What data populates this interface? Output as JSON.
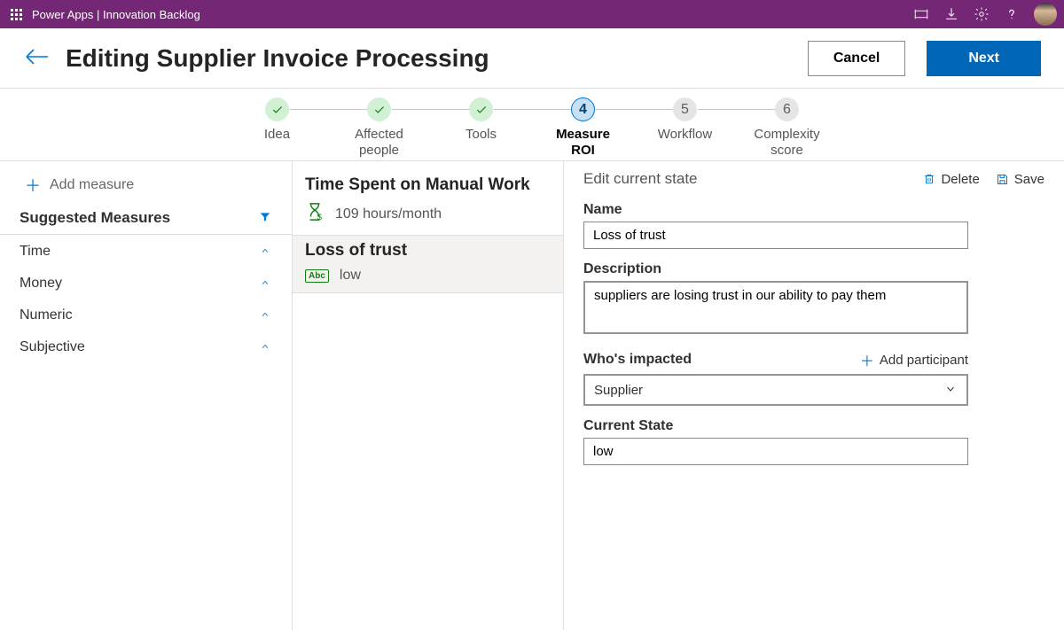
{
  "topbar": {
    "title": "Power Apps  |  Innovation Backlog"
  },
  "page": {
    "title": "Editing Supplier Invoice Processing",
    "cancel_label": "Cancel",
    "next_label": "Next"
  },
  "stepper": {
    "s1": "Idea",
    "s2": "Affected\npeople",
    "s3": "Tools",
    "s4_num": "4",
    "s4": "Measure\nROI",
    "s5_num": "5",
    "s5": "Workflow",
    "s6_num": "6",
    "s6": "Complexity\nscore"
  },
  "left": {
    "add_measure": "Add measure",
    "suggested": "Suggested Measures",
    "cat1": "Time",
    "cat2": "Money",
    "cat3": "Numeric",
    "cat4": "Subjective"
  },
  "middle": {
    "card1_title": "Time Spent on Manual Work",
    "card1_sub": "109 hours/month",
    "card2_title": "Loss of trust",
    "card2_badge": "Abc",
    "card2_sub": "low"
  },
  "form": {
    "edit_label": "Edit current state",
    "delete_label": "Delete",
    "save_label": "Save",
    "name_label": "Name",
    "name_value": "Loss of trust",
    "desc_label": "Description",
    "desc_value": "suppliers are losing trust in our ability to pay them",
    "who_label": "Who's impacted",
    "add_participant": "Add participant",
    "who_value": "Supplier",
    "state_label": "Current State",
    "state_value": "low"
  }
}
